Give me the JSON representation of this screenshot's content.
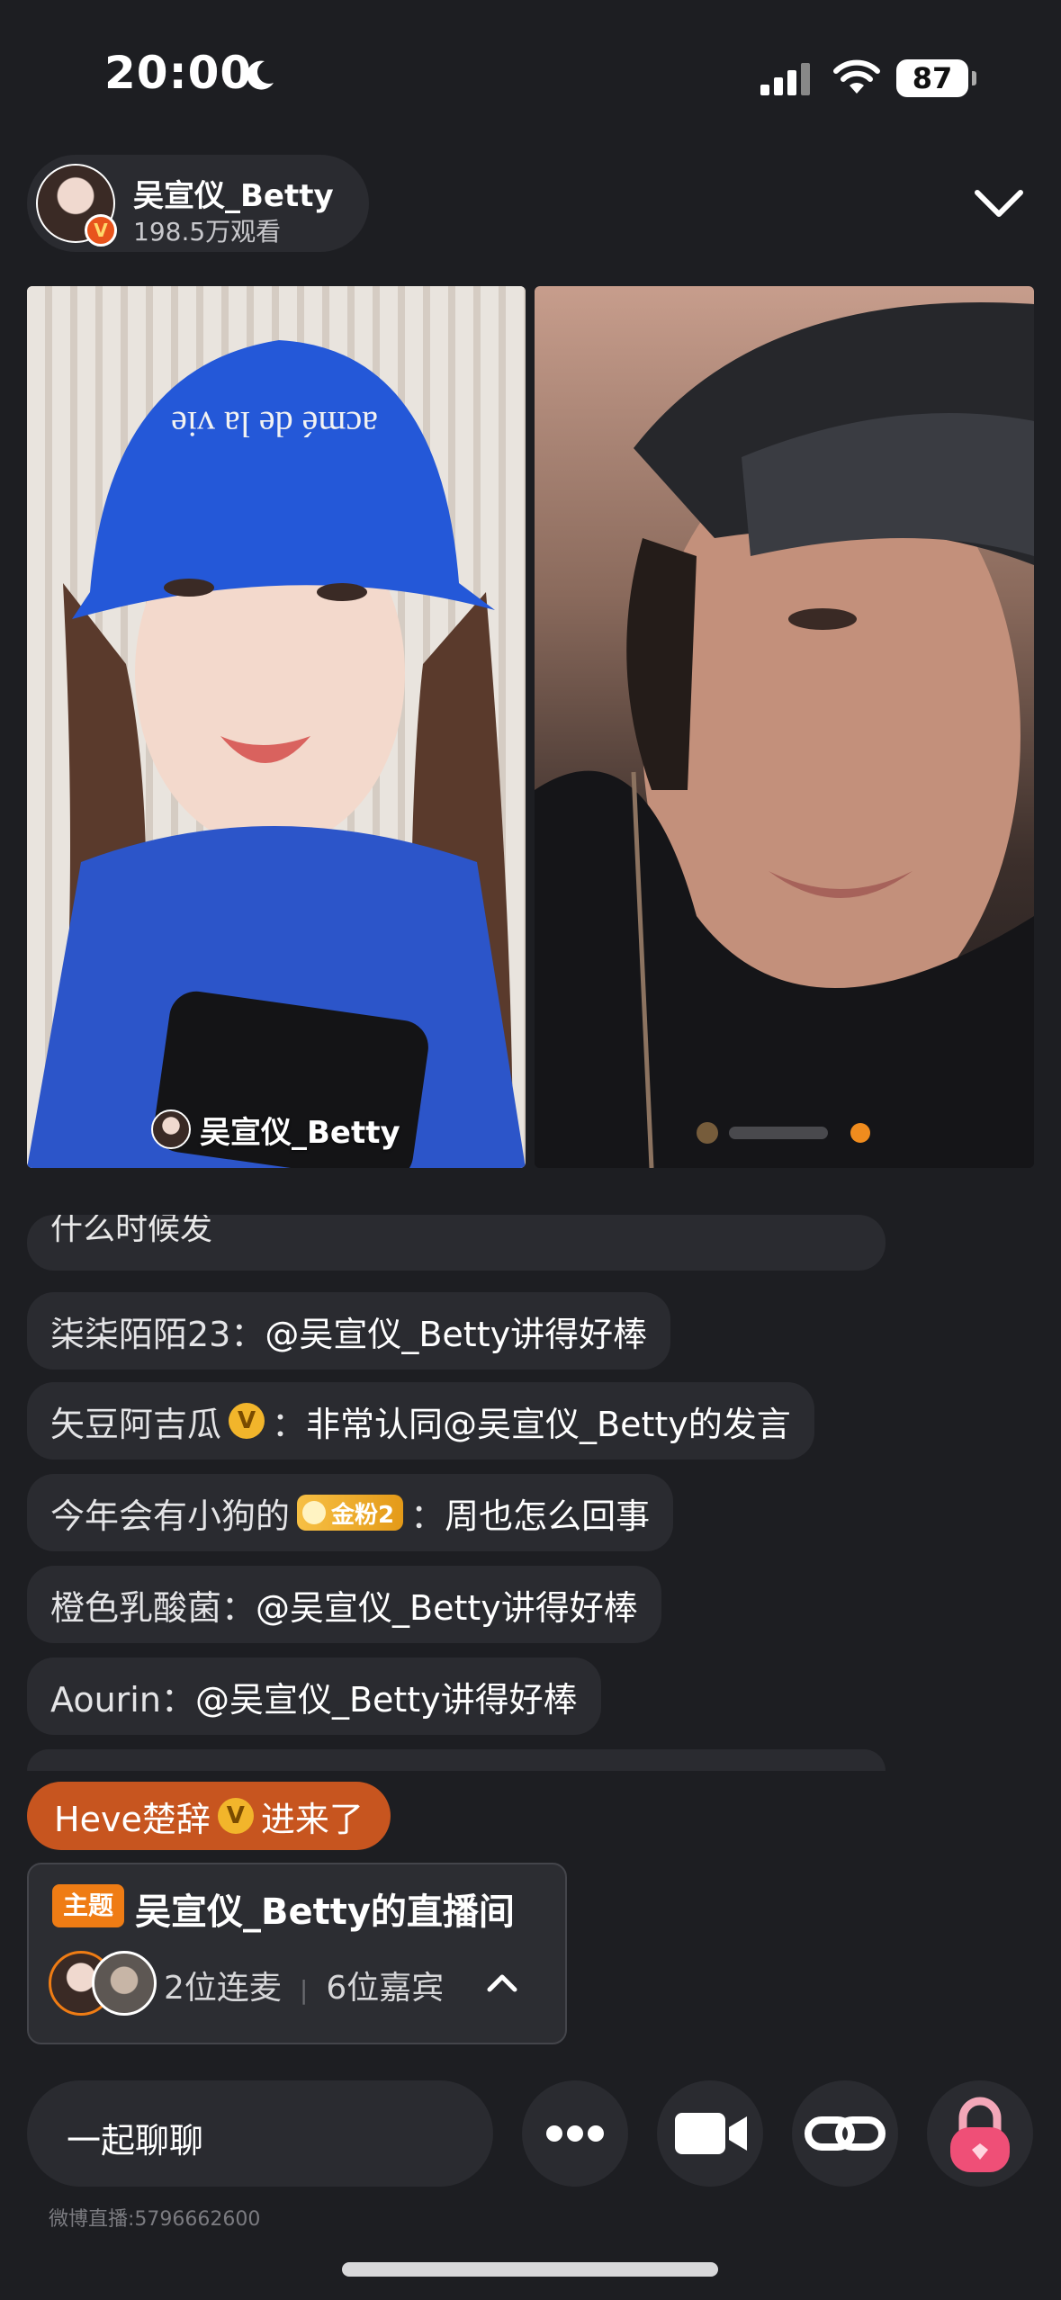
{
  "status_bar": {
    "time": "20:00",
    "battery": "87",
    "icons": [
      "moon-icon",
      "signal-icon",
      "wifi-icon",
      "battery-icon"
    ]
  },
  "host": {
    "name": "吴宣仪_Betty",
    "viewers": "198.5万观看",
    "badge": "V"
  },
  "video": {
    "left_label": "吴宣仪_Betty"
  },
  "comments": {
    "cut_top": "什么时候发",
    "items": [
      {
        "user": "柒柒陌陌23：",
        "msg": "@吴宣仪_Betty讲得好棒"
      },
      {
        "user": "矢豆阿吉瓜",
        "badge": "V",
        "sep": "：",
        "msg": "非常认同@吴宣仪_Betty的发言"
      },
      {
        "user": "今年会有小狗的",
        "fan_badge": "金粉2",
        "sep": "：",
        "msg": "周也怎么回事"
      },
      {
        "user": "橙色乳酸菌：",
        "msg": "@吴宣仪_Betty讲得好棒"
      },
      {
        "user": "Aourin：",
        "msg": "@吴宣仪_Betty讲得好棒"
      }
    ]
  },
  "enter_notice": {
    "user": "Heve楚辞",
    "badge": "V",
    "text": "进来了"
  },
  "topic": {
    "tag": "主题",
    "title": "吴宣仪_Betty的直播间",
    "co_hosts": "2位连麦",
    "guests": "6位嘉宾"
  },
  "bottom": {
    "chat_placeholder": "一起聊聊",
    "footer_id": "微博直播:5796662600"
  },
  "colors": {
    "background": "#1d1e22",
    "bubble": "#2a2b30",
    "accent_orange": "#ef7c14",
    "enter_pill": "#c7551f",
    "v_badge": "#f2b52b"
  }
}
